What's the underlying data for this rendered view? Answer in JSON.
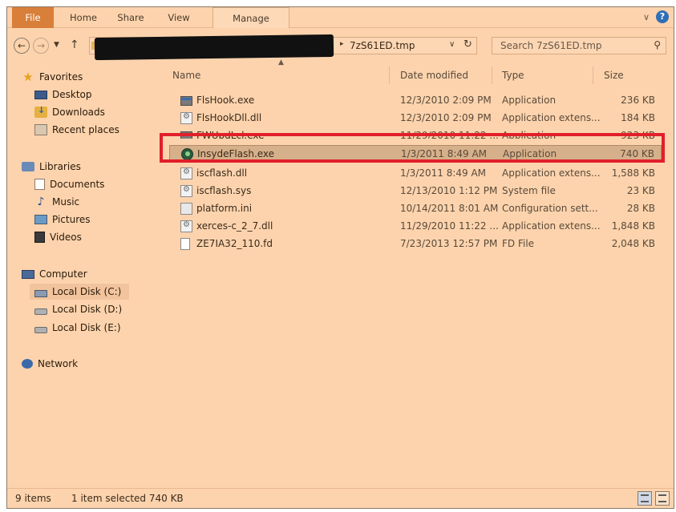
{
  "ribbon": {
    "tabs": [
      "File",
      "Home",
      "Share",
      "View",
      "Manage"
    ],
    "expand_icon": "chevron-down-icon",
    "help_icon": "help-icon",
    "help_label": "?"
  },
  "address_bar": {
    "back_icon": "back-arrow-icon",
    "forward_icon": "forward-arrow-icon",
    "up_icon": "up-arrow-icon",
    "current_folder": "7zS61ED.tmp",
    "path_redacted": true
  },
  "search": {
    "placeholder": "Search 7zS61ED.tmp"
  },
  "nav_pane": {
    "favorites": {
      "label": "Favorites",
      "items": [
        "Desktop",
        "Downloads",
        "Recent places"
      ]
    },
    "libraries": {
      "label": "Libraries",
      "items": [
        "Documents",
        "Music",
        "Pictures",
        "Videos"
      ]
    },
    "computer": {
      "label": "Computer",
      "items": [
        "Local Disk (C:)",
        "Local Disk (D:)",
        "Local Disk (E:)"
      ],
      "selected": "Local Disk (C:)"
    },
    "network": {
      "label": "Network"
    }
  },
  "columns": {
    "name": "Name",
    "date": "Date modified",
    "type": "Type",
    "size": "Size"
  },
  "files": [
    {
      "name": "FlsHook.exe",
      "date": "12/3/2010 2:09 PM",
      "type": "Application",
      "size": "236 KB",
      "icon": "exe-icon"
    },
    {
      "name": "FlsHookDll.dll",
      "date": "12/3/2010 2:09 PM",
      "type": "Application extens...",
      "size": "184 KB",
      "icon": "dll-icon"
    },
    {
      "name": "FWUpdLcl.exe",
      "date": "11/29/2010 11:22 ...",
      "type": "Application",
      "size": "923 KB",
      "icon": "exe-icon"
    },
    {
      "name": "InsydeFlash.exe",
      "date": "1/3/2011 8:49 AM",
      "type": "Application",
      "size": "740 KB",
      "icon": "insyde-flash-icon",
      "selected": true
    },
    {
      "name": "iscflash.dll",
      "date": "1/3/2011 8:49 AM",
      "type": "Application extens...",
      "size": "1,588 KB",
      "icon": "dll-icon"
    },
    {
      "name": "iscflash.sys",
      "date": "12/13/2010 1:12 PM",
      "type": "System file",
      "size": "23 KB",
      "icon": "sys-icon"
    },
    {
      "name": "platform.ini",
      "date": "10/14/2011 8:01 AM",
      "type": "Configuration sett...",
      "size": "28 KB",
      "icon": "ini-icon"
    },
    {
      "name": "xerces-c_2_7.dll",
      "date": "11/29/2010 11:22 ...",
      "type": "Application extens...",
      "size": "1,848 KB",
      "icon": "dll-icon"
    },
    {
      "name": "ZE7IA32_110.fd",
      "date": "7/23/2013 12:57 PM",
      "type": "FD File",
      "size": "2,048 KB",
      "icon": "file-icon"
    }
  ],
  "status_bar": {
    "item_count": "9 items",
    "selection": "1 item selected 740 KB"
  },
  "annotation": {
    "highlight_color": "#e0202a",
    "highlighted_file": "InsydeFlash.exe"
  },
  "theme": {
    "background": "#fcd3ad",
    "file_tab": "#d87f3a",
    "selection": "#d6b08a"
  }
}
